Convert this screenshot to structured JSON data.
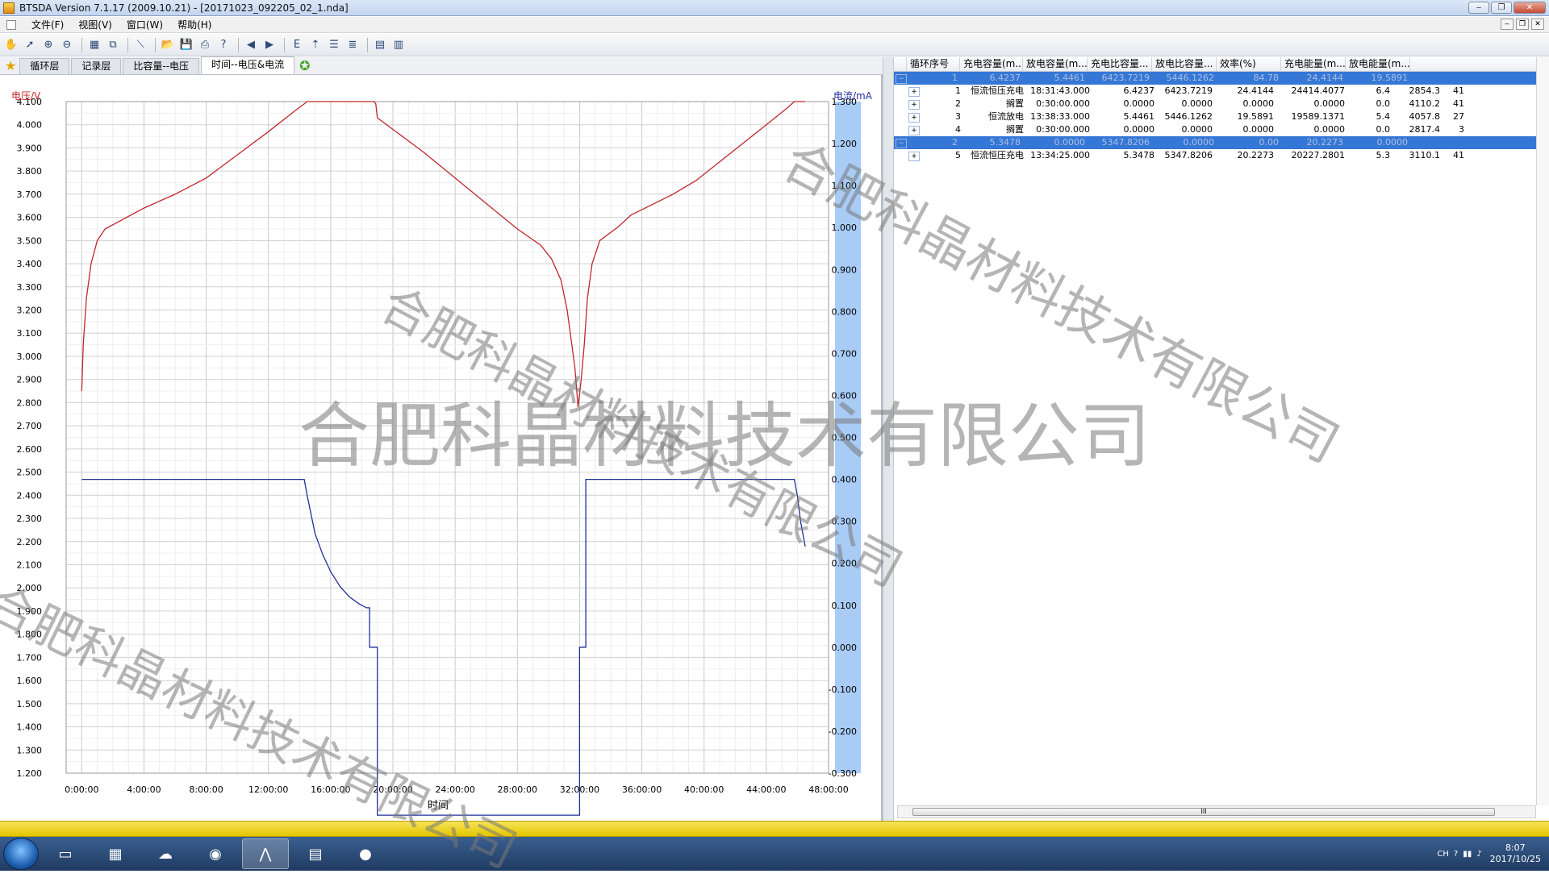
{
  "window": {
    "title": "BTSDA Version 7.1.17 (2009.10.21)    - [20171023_092205_02_1.nda]"
  },
  "menu": [
    "文件(F)",
    "视图(V)",
    "窗口(W)",
    "帮助(H)"
  ],
  "tabs": [
    {
      "label": "循环层",
      "active": false
    },
    {
      "label": "记录层",
      "active": false
    },
    {
      "label": "比容量--电压",
      "active": false
    },
    {
      "label": "时间--电压&电流",
      "active": true
    }
  ],
  "chart_data": {
    "type": "line",
    "title": "",
    "xlabel": "时间",
    "ylabel": "电压/V",
    "y2label": "电流/mA",
    "xticks": [
      "0:00:00",
      "4:00:00",
      "8:00:00",
      "12:00:00",
      "16:00:00",
      "20:00:00",
      "24:00:00",
      "28:00:00",
      "32:00:00",
      "36:00:00",
      "40:00:00",
      "44:00:00",
      "48:00:00"
    ],
    "xlim_hours": [
      -1,
      48
    ],
    "ylim": [
      1.2,
      4.1
    ],
    "y2lim": [
      -0.3,
      1.3
    ],
    "yticks": [
      "4.100",
      "4.000",
      "3.900",
      "3.800",
      "3.700",
      "3.600",
      "3.500",
      "3.400",
      "3.300",
      "3.200",
      "3.100",
      "3.000",
      "2.900",
      "2.800",
      "2.700",
      "2.600",
      "2.500",
      "2.400",
      "2.300",
      "2.200",
      "2.100",
      "2.000",
      "1.900",
      "1.800",
      "1.700",
      "1.600",
      "1.500",
      "1.400",
      "1.300",
      "1.200"
    ],
    "y2ticks": [
      "1.300",
      "1.200",
      "1.100",
      "1.000",
      "0.900",
      "0.800",
      "0.700",
      "0.600",
      "0.500",
      "0.400",
      "0.300",
      "0.200",
      "0.100",
      "0.000",
      "-0.100",
      "-0.200",
      "-0.300"
    ],
    "grid": true,
    "series": [
      {
        "axis": "left",
        "color": "#c0262c",
        "points": [
          [
            0,
            2.85
          ],
          [
            0.1,
            3.05
          ],
          [
            0.3,
            3.25
          ],
          [
            0.6,
            3.4
          ],
          [
            1,
            3.5
          ],
          [
            1.5,
            3.55
          ],
          [
            4,
            3.64
          ],
          [
            6,
            3.7
          ],
          [
            8,
            3.77
          ],
          [
            10,
            3.87
          ],
          [
            12,
            3.97
          ],
          [
            13.7,
            4.06
          ],
          [
            14.5,
            4.1
          ],
          [
            18.8,
            4.1
          ],
          [
            18.9,
            4.09
          ],
          [
            19,
            4.03
          ],
          [
            20,
            3.98
          ],
          [
            22,
            3.88
          ],
          [
            24,
            3.77
          ],
          [
            26,
            3.66
          ],
          [
            28,
            3.55
          ],
          [
            29.5,
            3.48
          ],
          [
            30.2,
            3.42
          ],
          [
            30.8,
            3.33
          ],
          [
            31.2,
            3.2
          ],
          [
            31.5,
            3.05
          ],
          [
            31.7,
            2.95
          ],
          [
            31.9,
            2.78
          ],
          [
            32.1,
            2.9
          ],
          [
            32.3,
            3.05
          ],
          [
            32.5,
            3.25
          ],
          [
            32.8,
            3.4
          ],
          [
            33.3,
            3.5
          ],
          [
            34.5,
            3.56
          ],
          [
            35.3,
            3.61
          ],
          [
            36.5,
            3.65
          ],
          [
            38,
            3.7
          ],
          [
            39.5,
            3.76
          ],
          [
            41,
            3.84
          ],
          [
            42.5,
            3.92
          ],
          [
            44,
            4.0
          ],
          [
            45.3,
            4.07
          ],
          [
            45.8,
            4.1
          ],
          [
            46.5,
            4.1
          ]
        ]
      },
      {
        "axis": "right",
        "color": "#1f2f9a",
        "points": [
          [
            0,
            0.4
          ],
          [
            14.3,
            0.4
          ],
          [
            14.5,
            0.36
          ],
          [
            15,
            0.27
          ],
          [
            15.5,
            0.22
          ],
          [
            16,
            0.18
          ],
          [
            16.6,
            0.145
          ],
          [
            17.2,
            0.12
          ],
          [
            17.8,
            0.104
          ],
          [
            18.3,
            0.094
          ],
          [
            18.5,
            0.094
          ],
          [
            18.5,
            0.0
          ],
          [
            19.0,
            0.0
          ],
          [
            19.0,
            -0.4
          ],
          [
            32.0,
            -0.4
          ],
          [
            32.0,
            0.0
          ],
          [
            32.4,
            0.0
          ],
          [
            32.4,
            0.4
          ],
          [
            45.8,
            0.4
          ],
          [
            46.0,
            0.36
          ],
          [
            46.2,
            0.3
          ],
          [
            46.5,
            0.24
          ]
        ]
      }
    ]
  },
  "table": {
    "columns": [
      "循环序号",
      "充电容量(m...",
      "放电容量(m...",
      "充电比容量...",
      "放电比容量...",
      "效率(%)",
      "充电能量(m...",
      "放电能量(m..."
    ],
    "rows": [
      {
        "kind": "group",
        "toggle": "−",
        "cells": [
          "1",
          "6.4237",
          "5.4461",
          "6423.7219",
          "5446.1262",
          "84.78",
          "24.4144",
          "19.5891"
        ]
      },
      {
        "kind": "step",
        "toggle": "+",
        "cells": [
          "1",
          "恒流恒压充电",
          "18:31:43.000",
          "6.4237",
          "6423.7219",
          "24.4144",
          "24414.4077",
          "6.4",
          "2854.3",
          "41"
        ]
      },
      {
        "kind": "step",
        "toggle": "+",
        "cells": [
          "2",
          "搁置",
          "0:30:00.000",
          "0.0000",
          "0.0000",
          "0.0000",
          "0.0000",
          "0.0",
          "4110.2",
          "41"
        ]
      },
      {
        "kind": "step",
        "toggle": "+",
        "cells": [
          "3",
          "恒流放电",
          "13:38:33.000",
          "5.4461",
          "5446.1262",
          "19.5891",
          "19589.1371",
          "5.4",
          "4057.8",
          "27"
        ]
      },
      {
        "kind": "step",
        "toggle": "+",
        "cells": [
          "4",
          "搁置",
          "0:30:00.000",
          "0.0000",
          "0.0000",
          "0.0000",
          "0.0000",
          "0.0",
          "2817.4",
          "3"
        ]
      },
      {
        "kind": "group",
        "toggle": "−",
        "cells": [
          "2",
          "5.3478",
          "0.0000",
          "5347.8206",
          "0.0000",
          "0.00",
          "20.2273",
          "0.0000"
        ]
      },
      {
        "kind": "step",
        "toggle": "+",
        "cells": [
          "5",
          "恒流恒压充电",
          "13:34:25.000",
          "5.3478",
          "5347.8206",
          "20.2273",
          "20227.2801",
          "5.3",
          "3110.1",
          "41"
        ]
      }
    ]
  },
  "scroll_grip": "III",
  "watermark": "合肥科晶材料技术有限公司",
  "taskbar": {
    "apps": [
      "folder-icon",
      "calculator-icon",
      "cloud-icon",
      "browser-icon",
      "waveform-icon",
      "document-icon",
      "globe-icon"
    ],
    "tray_lang": "CH",
    "clock_time": "8:07",
    "clock_date": "2017/10/25"
  }
}
